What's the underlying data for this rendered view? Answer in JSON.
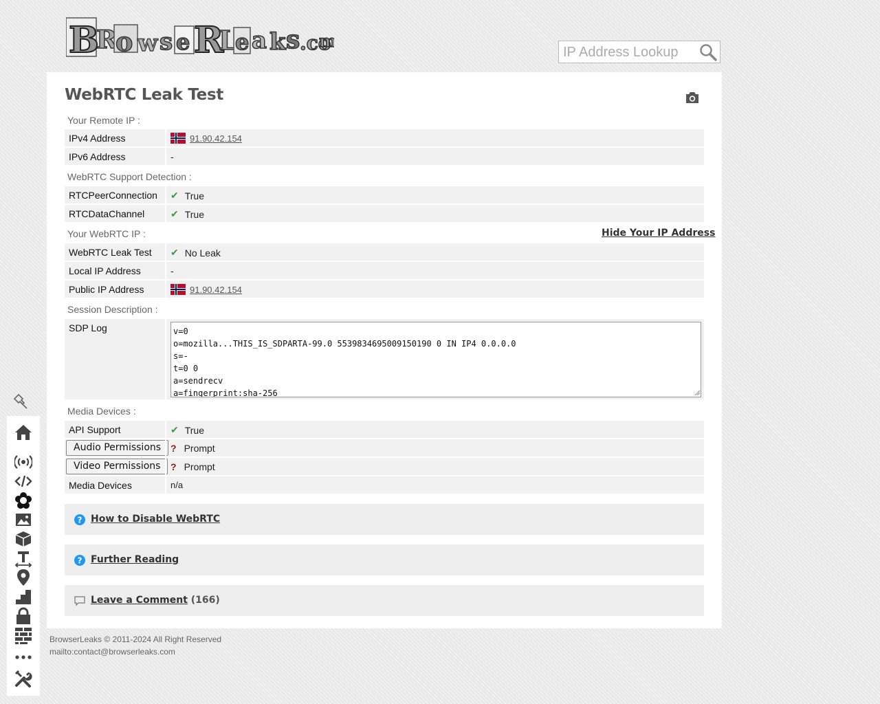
{
  "logo": {
    "text": "BrowserLeaks.com"
  },
  "search": {
    "placeholder": "IP Address Lookup"
  },
  "page": {
    "title": "WebRTC Leak Test"
  },
  "sections": {
    "remote_ip": "Your Remote IP :",
    "support": "WebRTC Support Detection :",
    "webrtc_ip": "Your WebRTC IP :",
    "session": "Session Description :",
    "media": "Media Devices :"
  },
  "remote": {
    "ipv4_label": "IPv4 Address",
    "ipv4_value": "91.90.42.154",
    "ipv6_label": "IPv6 Address",
    "ipv6_value": "-"
  },
  "support": {
    "peer_label": "RTCPeerConnection",
    "peer_value": "True",
    "channel_label": "RTCDataChannel",
    "channel_value": "True"
  },
  "webrtc": {
    "hide_link": "Hide Your IP Address",
    "leak_label": "WebRTC Leak Test",
    "leak_value": "No Leak",
    "local_label": "Local IP Address",
    "local_value": "-",
    "public_label": "Public IP Address",
    "public_value": "91.90.42.154"
  },
  "session": {
    "sdp_label": "SDP Log",
    "sdp_text": "v=0\no=mozilla...THIS_IS_SDPARTA-99.0 5539834695009150190 0 IN IP4 0.0.0.0\ns=-\nt=0 0\na=sendrecv\na=fingerprint:sha-256"
  },
  "media": {
    "api_label": "API Support",
    "api_value": "True",
    "audio_button": "Audio Permissions",
    "audio_value": "Prompt",
    "video_button": "Video Permissions",
    "video_value": "Prompt",
    "devices_label": "Media Devices",
    "devices_value": "n/a",
    "check_mark": "✔",
    "question_mark": "?"
  },
  "accordions": {
    "disable": "How to Disable WebRTC",
    "reading": "Further Reading",
    "comment": "Leave a Comment",
    "comment_count": "(166)"
  },
  "footer": {
    "copyright": "BrowserLeaks © 2011-2024 All Right Reserved",
    "email": "mailto:contact@browserleaks.com"
  },
  "colors": {
    "check": "#3a9a4a",
    "question": "#8b1a1a",
    "info": "#2196f3",
    "flag_red": "#ba0c2f",
    "flag_blue": "#00205b"
  },
  "sidebar_icons": [
    "pin-icon",
    "home-icon",
    "broadcast-icon",
    "code-icon",
    "flower-icon",
    "image-icon",
    "cube-icon",
    "text-height-icon",
    "map-marker-icon",
    "stairs-icon",
    "lock-icon",
    "brick-wall-icon",
    "more-icon",
    "tools-icon"
  ]
}
